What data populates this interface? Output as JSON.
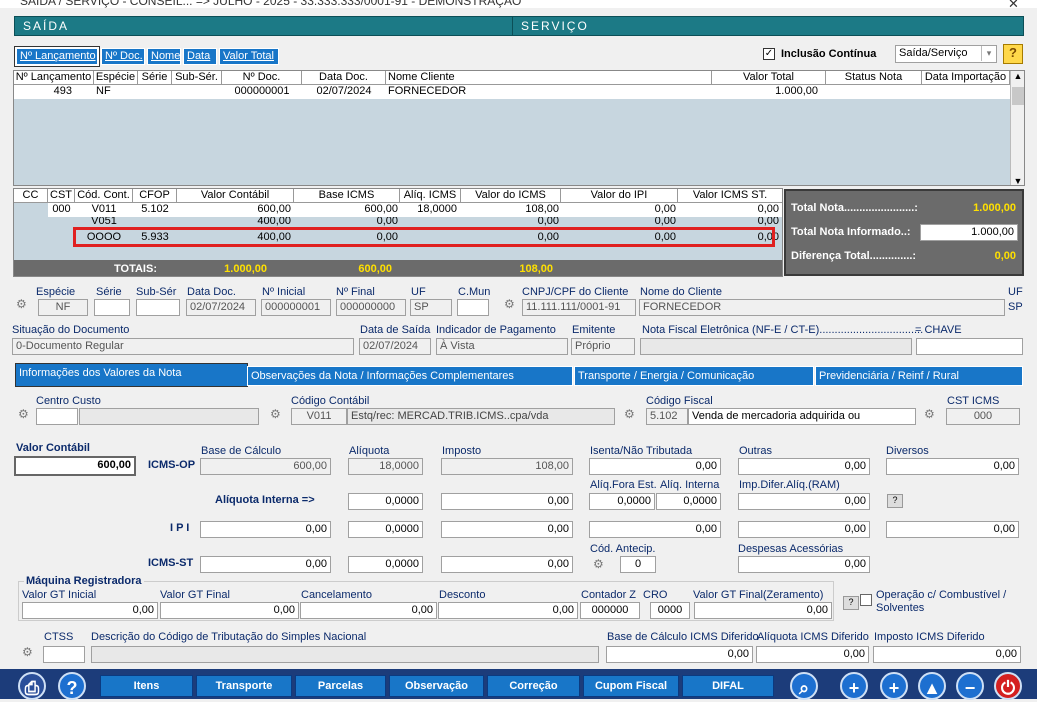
{
  "window": {
    "title": "SAÍDA / SERVIÇO - CONSEIL... => JULHO - 2025 - 33.333.333/0001-91 - DEMONSTRAÇÃO",
    "close": "✕"
  },
  "header": {
    "left": "SAÍDA",
    "right": "SERVIÇO"
  },
  "toptabs": [
    "Nº Lançamento",
    "Nº Doc.",
    "Nome",
    "Data",
    "Valor Total"
  ],
  "inclusao": "Inclusão Contínua",
  "tipo": "Saída/Serviço",
  "help": "?",
  "grid1": {
    "headers": [
      "Nº Lançamento",
      "Espécie",
      "Série",
      "Sub-Sér.",
      "Nº Doc.",
      "Data Doc.",
      "Nome Cliente",
      "Valor Total",
      "Status Nota",
      "Data Importação"
    ],
    "row": [
      "493",
      "NF",
      "",
      "",
      "000000001",
      "02/07/2024",
      "FORNECEDOR",
      "1.000,00",
      "",
      ""
    ]
  },
  "grid2": {
    "headers": [
      "CC",
      "CST",
      "Cód. Cont.",
      "CFOP",
      "Valor Contábil",
      "Base ICMS",
      "Alíq. ICMS",
      "Valor do ICMS",
      "Valor do IPI",
      "Valor ICMS ST."
    ],
    "rows": [
      [
        "",
        "000",
        "V011",
        "5.102",
        "600,00",
        "600,00",
        "18,0000",
        "108,00",
        "0,00",
        "0,00"
      ],
      [
        "",
        "",
        "V051",
        "",
        "400,00",
        "0,00",
        "",
        "0,00",
        "0,00",
        "0,00"
      ],
      [
        "",
        "",
        "OOOO",
        "5.933",
        "400,00",
        "0,00",
        "",
        "0,00",
        "0,00",
        "0,00"
      ]
    ],
    "totais_label": "TOTAIS:",
    "totais": [
      "1.000,00",
      "600,00",
      "108,00"
    ]
  },
  "totals": {
    "total_nota_label": "Total Nota.......................:",
    "total_nota": "1.000,00",
    "informado_label": "Total Nota Informado..:",
    "informado": "1.000,00",
    "diferenca_label": "Diferença Total..............:",
    "diferenca": "0,00"
  },
  "doc": {
    "especie_l": "Espécie",
    "especie": "NF",
    "serie_l": "Série",
    "subser_l": "Sub-Sér",
    "datadoc_l": "Data Doc.",
    "datadoc": "02/07/2024",
    "ninicial_l": "Nº Inicial",
    "ninicial": "000000001",
    "nfinal_l": "Nº Final",
    "nfinal": "000000000",
    "uf_l": "UF",
    "uf": "SP",
    "cmun_l": "C.Mun",
    "cnpj_l": "CNPJ/CPF do Cliente",
    "cnpj": "11.111.111/0001-91",
    "nomecli_l": "Nome do Cliente",
    "nomecli": "FORNECEDOR",
    "uf2_l": "UF",
    "uf2": "SP"
  },
  "sit": {
    "sit_l": "Situação do Documento",
    "sit": "0-Documento Regular",
    "datasaida_l": "Data de Saída",
    "datasaida": "02/07/2024",
    "indpag_l": "Indicador de Pagamento",
    "indpag": "À Vista",
    "emit_l": "Emitente",
    "emit": "Próprio",
    "nfe_l": "Nota Fiscal Eletrônica (NF-E / CT-E)..................................",
    "chave_l": "=  CHAVE"
  },
  "tabs": [
    "Informações dos Valores da Nota",
    "Observações da Nota / Informações Complementares",
    "Transporte / Energia / Comunicação",
    "Previdenciária / Reinf / Rural"
  ],
  "cc": {
    "centro_l": "Centro Custo",
    "codcont_l": "Código Contábil",
    "codcont": "V011",
    "codcont_desc": "Estq/rec: MERCAD.TRIB.ICMS..cpa/vda",
    "codfis_l": "Código Fiscal",
    "codfis": "5.102",
    "codfis_desc": "Venda de mercadoria adquirida ou",
    "cst_l": "CST ICMS",
    "cst": "000"
  },
  "vals": {
    "valorcont_l": "Valor Contábil",
    "valorcont": "600,00",
    "icmsop": "ICMS-OP",
    "base_l": "Base de Cálculo",
    "aliq_l": "Alíquota",
    "imposto_l": "Imposto",
    "isenta_l": "Isenta/Não Tributada",
    "outras_l": "Outras",
    "diversos_l": "Diversos",
    "base": "600,00",
    "aliq": "18,0000",
    "imposto": "108,00",
    "isenta": "0,00",
    "outras": "0,00",
    "diversos": "0,00",
    "aliqint_l": "Alíquota Interna =>",
    "aliqfora_l": "Alíq.Fora Est.",
    "aliqinterna_l": "Alíq. Interna",
    "impdifer_l": "Imp.Difer.Alíq.(RAM)",
    "ai1": "0,0000",
    "ai2": "0,00",
    "af": "0,0000",
    "ain": "0,0000",
    "idf": "0,00",
    "ipi_l": "I P I",
    "ipi1": "0,00",
    "ipi2": "0,0000",
    "ipi3": "0,00",
    "ipi4": "0,00",
    "ipi5": "0,00",
    "ipi6": "0,00",
    "st_l": "ICMS-ST",
    "st1": "0,00",
    "st2": "0,0000",
    "st3": "0,00",
    "codant_l": "Cód. Antecip.",
    "codant": "0",
    "desp_l": "Despesas Acessórias",
    "desp": "0,00"
  },
  "maq": {
    "title": "Máquina Registradora",
    "gti_l": "Valor GT Inicial",
    "gti": "0,00",
    "gtf_l": "Valor GT Final",
    "gtf": "0,00",
    "canc_l": "Cancelamento",
    "canc": "0,00",
    "desc_l": "Desconto",
    "desc": "0,00",
    "cz_l": "Contador Z",
    "cz": "000000",
    "cro_l": "CRO",
    "cro": "0000",
    "gtz_l": "Valor GT Final(Zeramento)",
    "gtz": "0,00",
    "comb_l": "Operação c/ Combustível / Solventes"
  },
  "simples": {
    "ctss_l": "CTSS",
    "desc_l": "Descrição do Código de Tributação do Simples Nacional",
    "base_l": "Base de Cálculo ICMS Diferido",
    "aliq_l": "Alíquota ICMS Diferido",
    "imp_l": "Imposto ICMS Diferido",
    "base": "0,00",
    "aliq": "0,00",
    "imp": "0,00"
  },
  "bottom": [
    "Itens",
    "Transporte",
    "Parcelas",
    "Observação",
    "Correção",
    "Cupom Fiscal",
    "DIFAL"
  ],
  "colors": {
    "teal": "#1c7a86",
    "blue": "#1876c8",
    "highlight": "#e02020",
    "yellow": "#ffe000"
  }
}
